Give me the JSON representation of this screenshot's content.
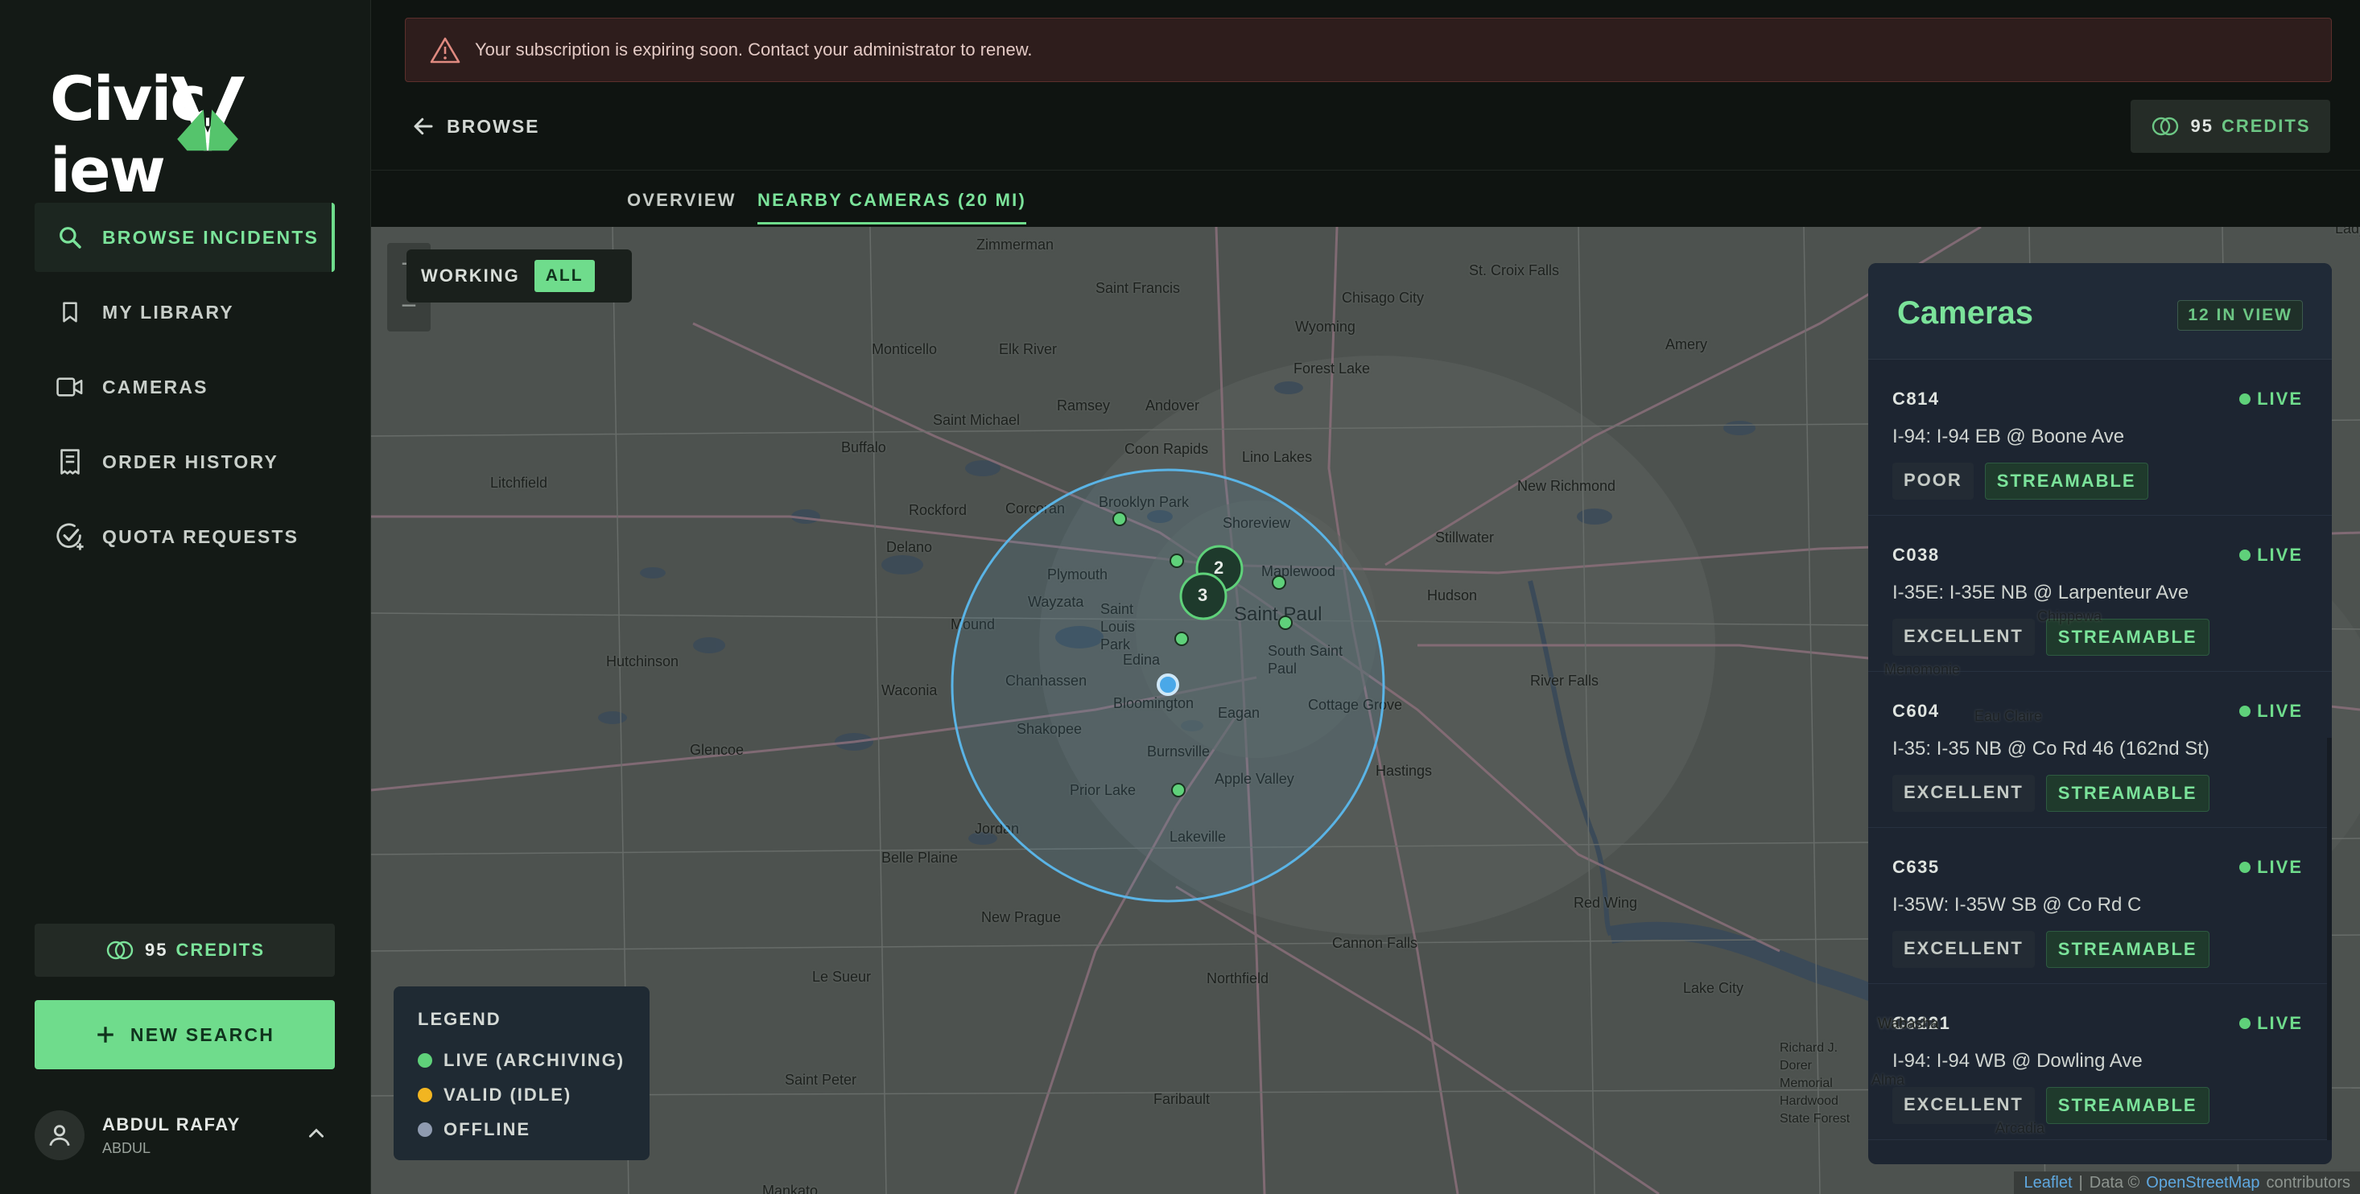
{
  "app": {
    "logo_text_a": "Civic",
    "logo_text_b": "iew"
  },
  "sidebar": {
    "items": [
      {
        "label": "BROWSE INCIDENTS",
        "icon": "search-icon",
        "active": true
      },
      {
        "label": "MY LIBRARY",
        "icon": "bookmark-icon",
        "active": false
      },
      {
        "label": "CAMERAS",
        "icon": "video-camera-icon",
        "active": false
      },
      {
        "label": "ORDER HISTORY",
        "icon": "receipt-icon",
        "active": false
      },
      {
        "label": "QUOTA REQUESTS",
        "icon": "check-badge-icon",
        "active": false
      }
    ],
    "credits_value": "95",
    "credits_label": "CREDITS",
    "new_search_label": "NEW SEARCH",
    "user": {
      "name": "ABDUL RAFAY",
      "sub": "ABDUL"
    }
  },
  "alert": {
    "text": "Your subscription is expiring soon. Contact your administrator to renew."
  },
  "topbar": {
    "back_label": "BROWSE",
    "credits_value": "95",
    "credits_label": "CREDITS"
  },
  "tabs": [
    {
      "label": "OVERVIEW",
      "active": false
    },
    {
      "label": "NEARBY CAMERAS (20 MI)",
      "active": true
    }
  ],
  "map": {
    "filter": {
      "working_label": "WORKING",
      "all_label": "ALL"
    },
    "zoom_in": "+",
    "zoom_out": "−",
    "clusters": [
      "2",
      "3"
    ],
    "places": [
      "Zimmerman",
      "Saint Francis",
      "St. Croix Falls",
      "Chisago City",
      "Wyoming",
      "Forest Lake",
      "Amery",
      "Monticello",
      "Elk River",
      "Ramsey",
      "Andover",
      "Saint Michael",
      "Coon Rapids",
      "Buffalo",
      "Lino Lakes",
      "Litchfield",
      "New Richmond",
      "Brooklyn Park",
      "Corcoran",
      "Rockford",
      "Shoreview",
      "Delano",
      "Plymouth",
      "Maplewood",
      "Stillwater",
      "Wayzata",
      "Saint Louis Park",
      "Saint Paul",
      "Hudson",
      "Mound",
      "South Saint Paul",
      "Hutchinson",
      "Edina",
      "Chanhassen",
      "Bloomington",
      "Eagan",
      "Cottage Grove",
      "River Falls",
      "Waconia",
      "Shakopee",
      "Glencoe",
      "Burnsville",
      "Apple Valley",
      "Hastings",
      "Prior Lake",
      "Jordan",
      "Lakeville",
      "Belle Plaine",
      "New Prague",
      "Red Wing",
      "Cannon Falls",
      "Le Sueur",
      "Northfield",
      "Lake City",
      "Saint Peter",
      "Faribault",
      "Wabasha",
      "Ladysmith",
      "Menomonie",
      "Eau Claire",
      "Chippewa",
      "Richard J. Dorer Memorial Hardwood State Forest",
      "Alma",
      "Arcadia",
      "Mankato"
    ],
    "legend": {
      "title": "LEGEND",
      "items": [
        {
          "label": "LIVE (ARCHIVING)",
          "color": "#5fd17a"
        },
        {
          "label": "VALID (IDLE)",
          "color": "#f2b521"
        },
        {
          "label": "OFFLINE",
          "color": "#8f9bb0"
        }
      ]
    },
    "attribution": {
      "leaflet": "Leaflet",
      "sep": "|",
      "data": "Data ©",
      "osm": "OpenStreetMap",
      "contrib": "contributors"
    }
  },
  "cameras": {
    "title": "Cameras",
    "count_label": "12 IN VIEW",
    "items": [
      {
        "id": "C814",
        "status": "LIVE",
        "location": "I-94: I-94 EB @ Boone Ave",
        "quality": "POOR",
        "stream": "STREAMABLE"
      },
      {
        "id": "C038",
        "status": "LIVE",
        "location": "I-35E: I-35E NB @ Larpenteur Ave",
        "quality": "EXCELLENT",
        "stream": "STREAMABLE"
      },
      {
        "id": "C604",
        "status": "LIVE",
        "location": "I-35: I-35 NB @ Co Rd 46 (162nd St)",
        "quality": "EXCELLENT",
        "stream": "STREAMABLE"
      },
      {
        "id": "C635",
        "status": "LIVE",
        "location": "I-35W: I-35W SB @ Co Rd C",
        "quality": "EXCELLENT",
        "stream": "STREAMABLE"
      },
      {
        "id": "C8221",
        "status": "LIVE",
        "location": "I-94: I-94 WB @ Dowling Ave",
        "quality": "EXCELLENT",
        "stream": "STREAMABLE"
      }
    ]
  },
  "colors": {
    "accent": "#6fdc8c",
    "radius": "#5ab4e6",
    "live": "#5fd17a"
  }
}
